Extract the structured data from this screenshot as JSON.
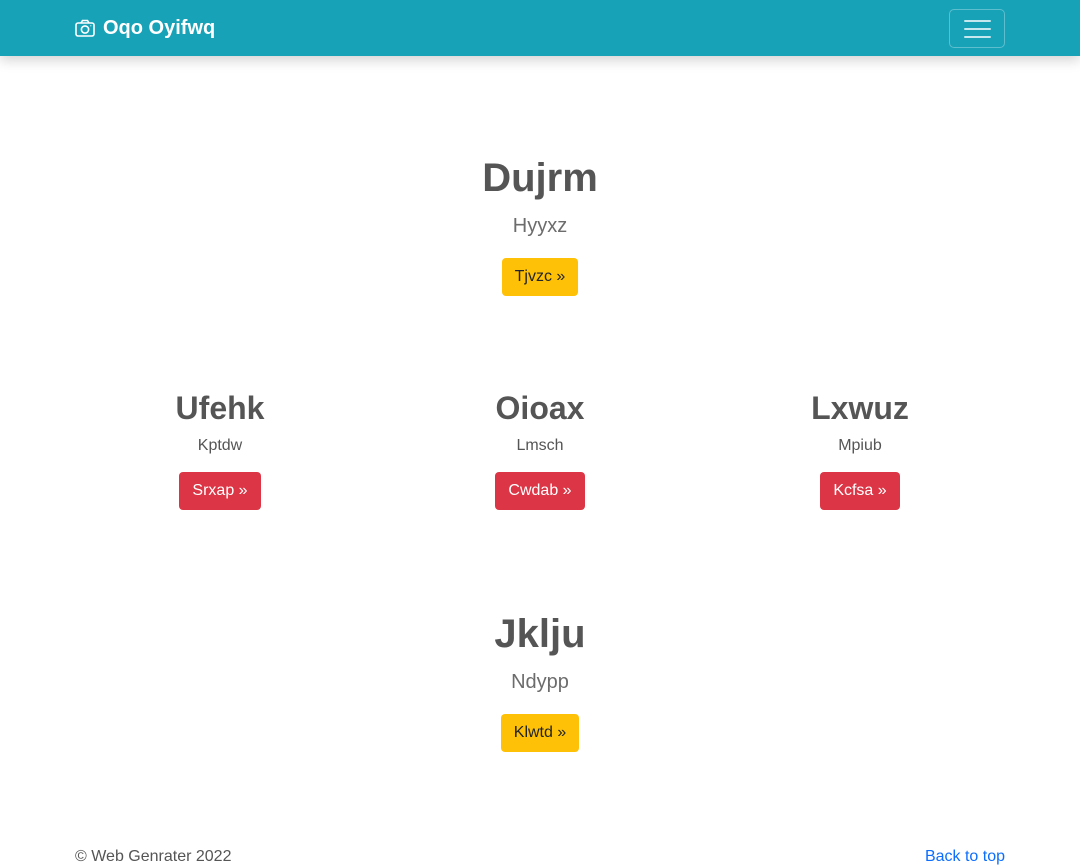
{
  "navbar": {
    "brand": "Oqo Oyifwq",
    "brand_icon": "camera-icon",
    "toggler_icon": "hamburger-menu-icon",
    "background": "#17a2b8"
  },
  "hero_top": {
    "title": "Dujrm",
    "subtitle": "Hyyxz",
    "button": "Tjvzc »",
    "button_color": "#ffc107"
  },
  "columns": [
    {
      "title": "Ufehk",
      "subtitle": "Kptdw",
      "button": "Srxap »"
    },
    {
      "title": "Oioax",
      "subtitle": "Lmsch",
      "button": "Cwdab »"
    },
    {
      "title": "Lxwuz",
      "subtitle": "Mpiub",
      "button": "Kcfsa »"
    }
  ],
  "columns_button_color": "#dc3545",
  "hero_bottom": {
    "title": "Jklju",
    "subtitle": "Ndypp",
    "button": "Klwtd »",
    "button_color": "#ffc107"
  },
  "footer": {
    "copyright": "© Web Genrater 2022",
    "back_to_top": "Back to top",
    "link_color": "#0d6efd"
  }
}
